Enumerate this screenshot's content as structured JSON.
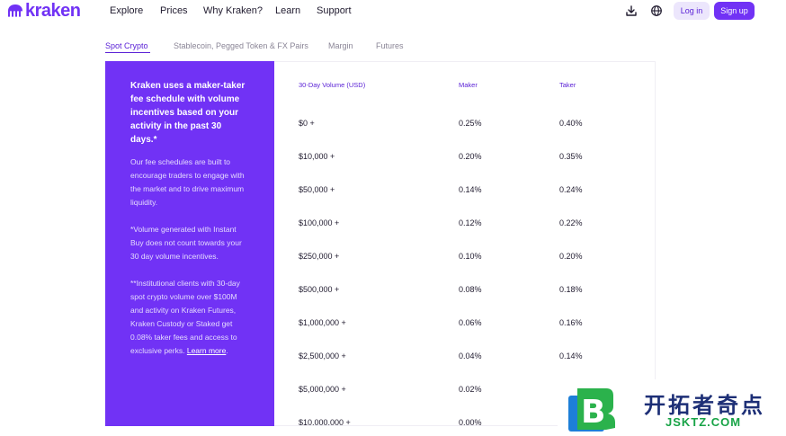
{
  "header": {
    "logo_text": "kraken",
    "nav": [
      "Explore",
      "Prices",
      "Why Kraken?",
      "Learn",
      "Support"
    ],
    "login_label": "Log in",
    "signup_label": "Sign up",
    "icons": [
      "download-icon",
      "globe-icon"
    ]
  },
  "tabs": [
    {
      "label": "Spot Crypto",
      "active": true
    },
    {
      "label": "Stablecoin, Pegged Token & FX Pairs",
      "active": false
    },
    {
      "label": "Margin",
      "active": false
    },
    {
      "label": "Futures",
      "active": false
    }
  ],
  "panel": {
    "heading": "Kraken uses a maker-taker fee schedule with volume incentives based on your activity in the past 30 days.*",
    "p1": "Our fee schedules are built to encourage traders to engage with the market and to drive maximum liquidity.",
    "p2": "*Volume generated with Instant Buy does not count towards your 30 day volume incentives.",
    "p3": "**Institutional clients with 30-day spot crypto volume over $100M and activity on Kraken Futures, Kraken Custody or Staked get 0.08% taker fees and access to exclusive perks.",
    "link": "Learn more",
    "link_suffix": "."
  },
  "table": {
    "headers": [
      "30-Day Volume (USD)",
      "Maker",
      "Taker"
    ],
    "rows": [
      {
        "volume": "$0 +",
        "maker": "0.25%",
        "taker": "0.40%"
      },
      {
        "volume": "$10,000 +",
        "maker": "0.20%",
        "taker": "0.35%"
      },
      {
        "volume": "$50,000 +",
        "maker": "0.14%",
        "taker": "0.24%"
      },
      {
        "volume": "$100,000 +",
        "maker": "0.12%",
        "taker": "0.22%"
      },
      {
        "volume": "$250,000 +",
        "maker": "0.10%",
        "taker": "0.20%"
      },
      {
        "volume": "$500,000 +",
        "maker": "0.08%",
        "taker": "0.18%"
      },
      {
        "volume": "$1,000,000 +",
        "maker": "0.06%",
        "taker": "0.16%"
      },
      {
        "volume": "$2,500,000 +",
        "maker": "0.04%",
        "taker": "0.14%"
      },
      {
        "volume": "$5,000,000 +",
        "maker": "0.02%",
        "taker": ""
      },
      {
        "volume": "$10,000,000 +",
        "maker": "0.00%",
        "taker": ""
      }
    ]
  },
  "watermark": {
    "text": "开拓者奇点",
    "subtext": "JSKTZ.COM"
  },
  "colors": {
    "brand": "#7132f5",
    "brand_dark": "#5b22d6",
    "login_bg": "#ece6fc",
    "watermark_blue": "#1d2f76",
    "watermark_green": "#17a346"
  }
}
